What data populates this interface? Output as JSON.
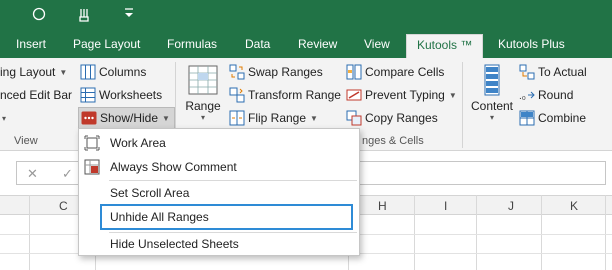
{
  "quick_access": {
    "circle_icon": "circle-icon",
    "touch_icon": "touch-mode-icon",
    "customize_icon": "customize-quick-access-icon"
  },
  "tabs": [
    {
      "label": "Insert"
    },
    {
      "label": "Page Layout"
    },
    {
      "label": "Formulas"
    },
    {
      "label": "Data"
    },
    {
      "label": "Review"
    },
    {
      "label": "View"
    },
    {
      "label": "Kutools ™"
    },
    {
      "label": "Kutools Plus"
    }
  ],
  "ribbon": {
    "view_group": {
      "reading_layout": "ing Layout",
      "enhanced_edit_bar": "nced Edit Bar",
      "columns": "Columns",
      "worksheets": "Worksheets",
      "show_hide": "Show/Hide",
      "label": "View"
    },
    "range_group": {
      "range": "Range",
      "swap_ranges": "Swap Ranges",
      "transform_range": "Transform Range",
      "flip_range": "Flip Range",
      "compare_cells": "Compare Cells",
      "prevent_typing": "Prevent Typing",
      "copy_ranges": "Copy Ranges",
      "label": "nges & Cells"
    },
    "content_group": {
      "content": "Content",
      "to_actual": "To Actual",
      "round": "Round",
      "combine": "Combine"
    }
  },
  "formula_bar": {
    "cancel_icon": "x-icon",
    "enter_icon": "check-icon"
  },
  "columns": [
    "C",
    "H",
    "I",
    "J",
    "K"
  ],
  "menu": {
    "items": [
      {
        "label": "Work Area"
      },
      {
        "label": "Always Show Comment"
      },
      {
        "label": "Set Scroll Area"
      },
      {
        "label": "Unhide All Ranges"
      },
      {
        "label": "Hide Unselected Sheets"
      }
    ]
  },
  "colors": {
    "brand": "#217346",
    "highlight": "#2e8bd6",
    "show_hide_icon": "#c0392b"
  }
}
